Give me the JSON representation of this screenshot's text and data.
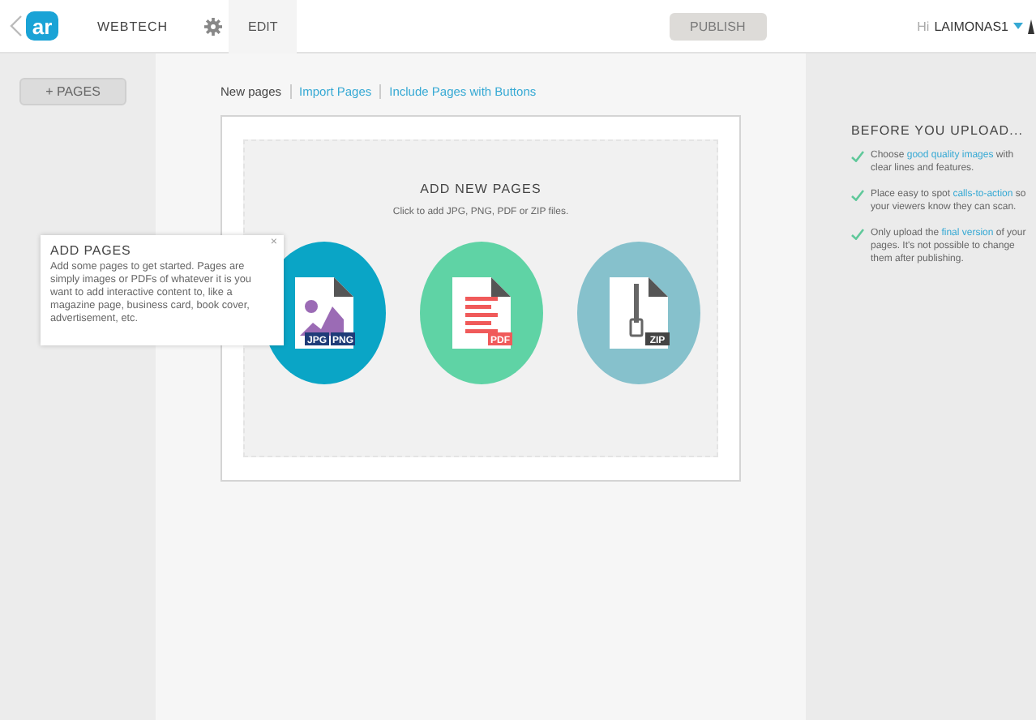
{
  "header": {
    "logo": "ar",
    "project": "WEBTECH",
    "tabs": [
      {
        "label": "EDIT",
        "selected": true
      }
    ],
    "publish": {
      "label": "PUBLISH",
      "disabled": true
    },
    "greeting": "Hi",
    "user": "LAIMONAS1"
  },
  "sidebar": {
    "add_button": "+ PAGES"
  },
  "content": {
    "links": [
      {
        "label": "New pages",
        "selected": true
      },
      {
        "label": "Import Pages",
        "selected": false
      },
      {
        "label": "Include Pages with Buttons",
        "selected": false
      }
    ],
    "upload": {
      "title": "ADD NEW PAGES",
      "subtitle": "Click to add JPG, PNG, PDF or ZIP files.",
      "options": [
        {
          "kind": "image",
          "color": "#0aa5c6",
          "tags": [
            "JPG",
            "PNG"
          ]
        },
        {
          "kind": "pdf",
          "color": "#5fd3a5",
          "tags": [
            "PDF"
          ]
        },
        {
          "kind": "zip",
          "color": "#86c1cc",
          "tags": [
            "ZIP"
          ]
        }
      ]
    }
  },
  "tooltip": {
    "title": "ADD PAGES",
    "text": "Add some pages to get started. Pages are simply images or PDFs of whatever it is you want to add interactive content to, like a magazine page, business card, book cover, advertisement, etc.",
    "close": "×"
  },
  "tips": {
    "title": "BEFORE YOU UPLOAD...",
    "items": [
      {
        "before": "Choose ",
        "link": "good quality images",
        "after": " with clear lines and features."
      },
      {
        "before": "Place easy to spot ",
        "link": "calls-to-action",
        "after": " so your viewers know they can scan."
      },
      {
        "before": "Only upload the ",
        "link": "final version",
        "after": " of your pages. It's not possible to change them after publishing."
      }
    ]
  }
}
